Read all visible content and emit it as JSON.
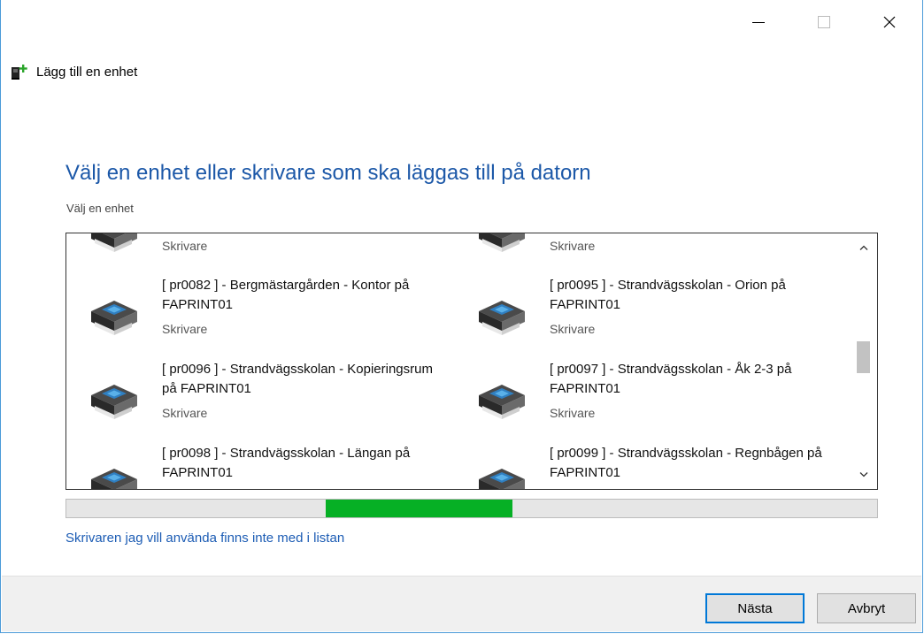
{
  "window": {
    "title": "Lägg till en enhet",
    "controls": [
      "minimize-icon",
      "maximize-icon",
      "close-icon"
    ]
  },
  "main": {
    "heading": "Välj en enhet eller skrivare som ska läggas till på datorn",
    "subheading": "Välj en enhet"
  },
  "devices": [
    {
      "name": "",
      "type": "Skrivare",
      "icon": "printer-icon"
    },
    {
      "name": "",
      "type": "Skrivare",
      "icon": "printer-icon"
    },
    {
      "name": "[ pr0082 ] - Bergmästargården - Kontor på FAPRINT01",
      "type": "Skrivare",
      "icon": "printer-icon"
    },
    {
      "name": "[ pr0095 ] - Strandvägsskolan - Orion på FAPRINT01",
      "type": "Skrivare",
      "icon": "printer-icon"
    },
    {
      "name": "[ pr0096 ] - Strandvägsskolan - Kopieringsrum på FAPRINT01",
      "type": "Skrivare",
      "icon": "printer-icon"
    },
    {
      "name": "[ pr0097 ] - Strandvägsskolan - Åk 2-3 på FAPRINT01",
      "type": "Skrivare",
      "icon": "printer-icon"
    },
    {
      "name": "[ pr0098 ] - Strandvägsskolan - Längan på FAPRINT01",
      "type": "",
      "icon": "printer-icon"
    },
    {
      "name": "[ pr0099 ] - Strandvägsskolan - Regnbågen på FAPRINT01",
      "type": "",
      "icon": "printer-icon"
    }
  ],
  "progress": {
    "state": "searching",
    "marquee_start": 0.32,
    "marquee_end": 0.55,
    "color": "#06b025"
  },
  "link": {
    "label": "Skrivaren jag vill använda finns inte med i listan"
  },
  "buttons": {
    "next": "Nästa",
    "cancel": "Avbryt"
  },
  "colors": {
    "heading": "#1c58a8",
    "link": "#1c5cb4",
    "accent": "#0078d7"
  }
}
